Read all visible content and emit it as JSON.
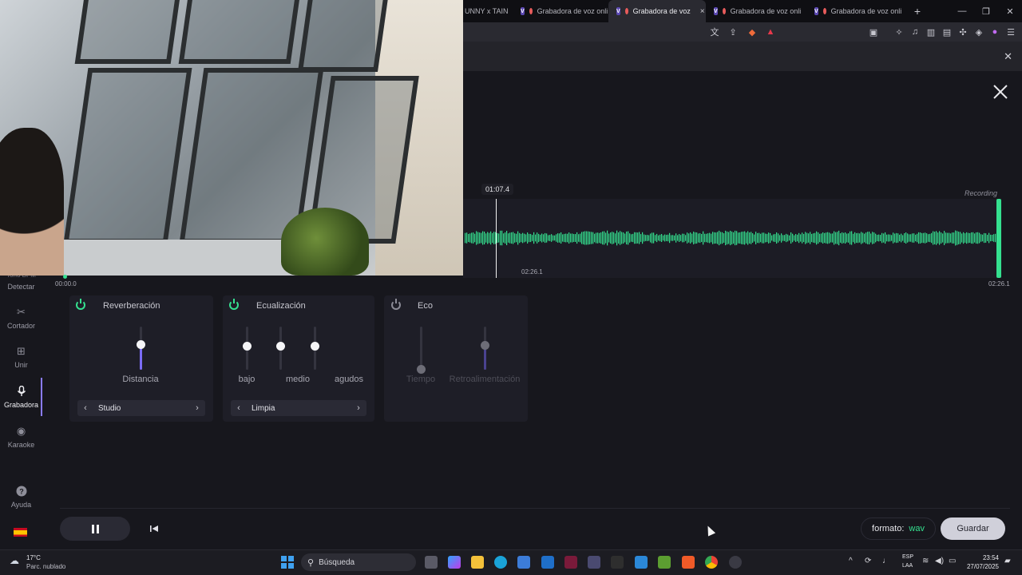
{
  "browser": {
    "tabs": [
      {
        "label": "UNNY x TAIN"
      },
      {
        "label": "Grabadora de voz onli"
      },
      {
        "label": "Grabadora de voz"
      },
      {
        "label": "Grabadora de voz onli"
      },
      {
        "label": "Grabadora de voz onli"
      }
    ],
    "new_tab": "+",
    "close_tab": "×"
  },
  "recorder": {
    "current_time": "01:07.4",
    "recording_label": "Recording",
    "wave_time": "02:26.1",
    "timeline_start": "00:00.0",
    "timeline_end": "02:26.1",
    "progress_fraction": 0.005,
    "wave_color": "#35e08f"
  },
  "sidebar": {
    "items": [
      {
        "label": "Detectar",
        "icon": "tono-bpm-icon"
      },
      {
        "label": "Cortador",
        "icon": "scissors-icon"
      },
      {
        "label": "Unir",
        "icon": "join-icon"
      },
      {
        "label": "Grabadora",
        "icon": "microphone-icon",
        "active": true
      },
      {
        "label": "Karaoke",
        "icon": "record-icon"
      },
      {
        "label": "Ayuda",
        "icon": "help-icon"
      }
    ],
    "partial_label": "Tono BPM"
  },
  "effects": {
    "reverb": {
      "title": "Reverberación",
      "enabled": true,
      "slider_label": "Distancia",
      "slider_value": 0.35,
      "preset": "Studio"
    },
    "eq": {
      "title": "Ecualización",
      "enabled": true,
      "sliders": [
        {
          "label": "bajo",
          "value": 0.5
        },
        {
          "label": "medio",
          "value": 0.5
        },
        {
          "label": "agudos",
          "value": 0.5
        }
      ],
      "preset": "Limpia"
    },
    "echo": {
      "title": "Eco",
      "enabled": false,
      "sliders": [
        {
          "label": "Tiempo",
          "value": 0.0
        },
        {
          "label": "Retroalimentación",
          "value": 0.5
        }
      ]
    }
  },
  "footer": {
    "format_label": "formato:",
    "format_value": "wav",
    "save_label": "Guardar"
  },
  "taskbar": {
    "temperature": "17°C",
    "weather": "Parc. nublado",
    "search_placeholder": "Búsqueda",
    "lang_1": "ESP",
    "lang_2": "LAA",
    "time": "23:54",
    "date": "27/07/2025"
  },
  "colors": {
    "accent_green": "#35e08f",
    "accent_purple": "#7b6cf6",
    "background": "#17171d"
  }
}
